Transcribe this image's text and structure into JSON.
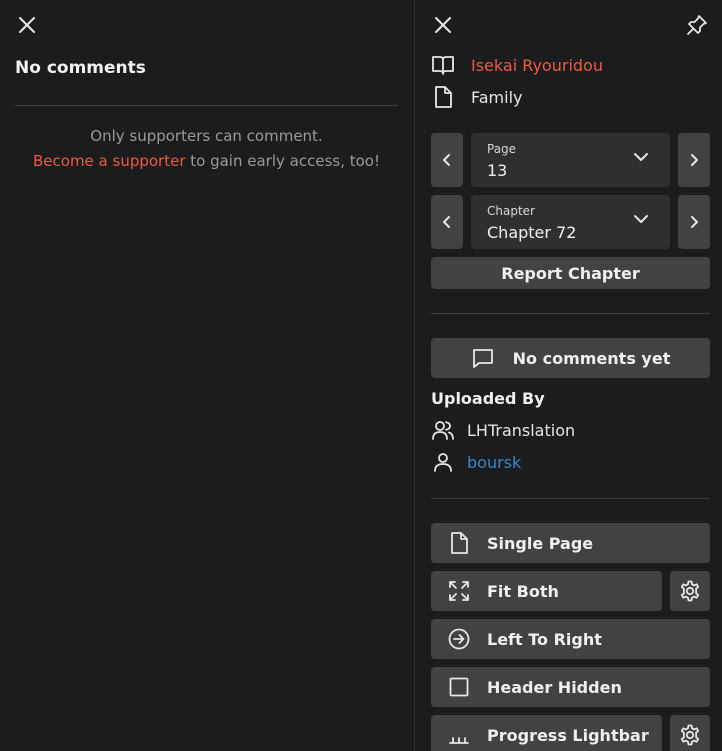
{
  "left_panel": {
    "title": "No comments",
    "message_line1": "Only supporters can comment.",
    "supporter_link": "Become a supporter",
    "message_rest": " to gain early access, too!"
  },
  "right_panel": {
    "manga_title": "Isekai Ryouridou",
    "chapter_name": "Family",
    "page_select": {
      "label": "Page",
      "value": "13"
    },
    "chapter_select": {
      "label": "Chapter",
      "value": "Chapter 72"
    },
    "report_button": "Report Chapter",
    "comments_button": "No comments yet",
    "uploaded_by_heading": "Uploaded By",
    "group": "LHTranslation",
    "uploader": "boursk",
    "options": {
      "page_mode": "Single Page",
      "fit": "Fit Both",
      "direction": "Left To Right",
      "header": "Header Hidden",
      "progress": "Progress Lightbar"
    }
  },
  "colors": {
    "accent": "#f05a3e",
    "link_blue": "#3a86c7",
    "background": "#1b1c1e",
    "button": "#414244"
  },
  "icons": [
    "close-icon",
    "pin-icon",
    "book-icon",
    "file-icon",
    "chevron-left-icon",
    "chevron-right-icon",
    "chevron-down-icon",
    "comment-icon",
    "users-icon",
    "user-icon",
    "expand-icon",
    "arrow-right-circle-icon",
    "square-icon",
    "progress-bar-icon",
    "gear-icon"
  ]
}
